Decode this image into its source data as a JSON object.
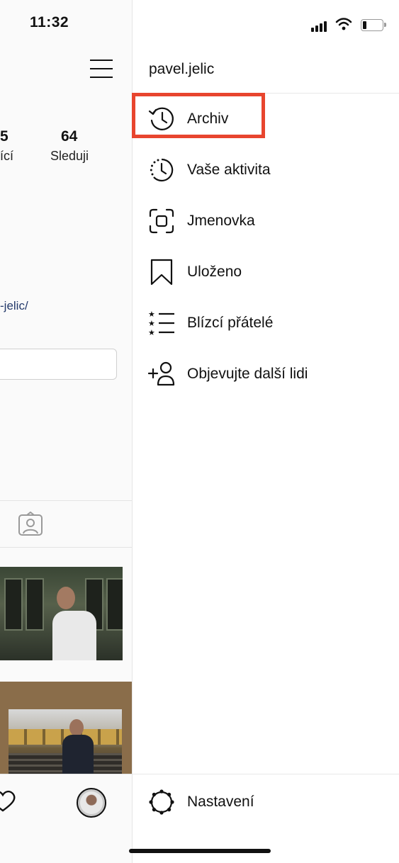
{
  "status_bar": {
    "time": "11:32"
  },
  "profile": {
    "stats": [
      {
        "number": "5",
        "label": "ící"
      },
      {
        "number": "64",
        "label": "Sleduji"
      }
    ],
    "link": "-jelic/"
  },
  "menu": {
    "username": "pavel.jelic",
    "items": [
      {
        "label": "Archiv",
        "icon": "history-icon"
      },
      {
        "label": "Vaše aktivita",
        "icon": "activity-icon"
      },
      {
        "label": "Jmenovka",
        "icon": "nametag-icon"
      },
      {
        "label": "Uloženo",
        "icon": "bookmark-icon"
      },
      {
        "label": "Blízcí přátelé",
        "icon": "close-friends-icon"
      },
      {
        "label": "Objevujte další lidi",
        "icon": "add-person-icon"
      }
    ],
    "settings": {
      "label": "Nastavení",
      "icon": "settings-icon"
    }
  },
  "colors": {
    "highlight": "#e8452e",
    "link": "#243a6b"
  }
}
